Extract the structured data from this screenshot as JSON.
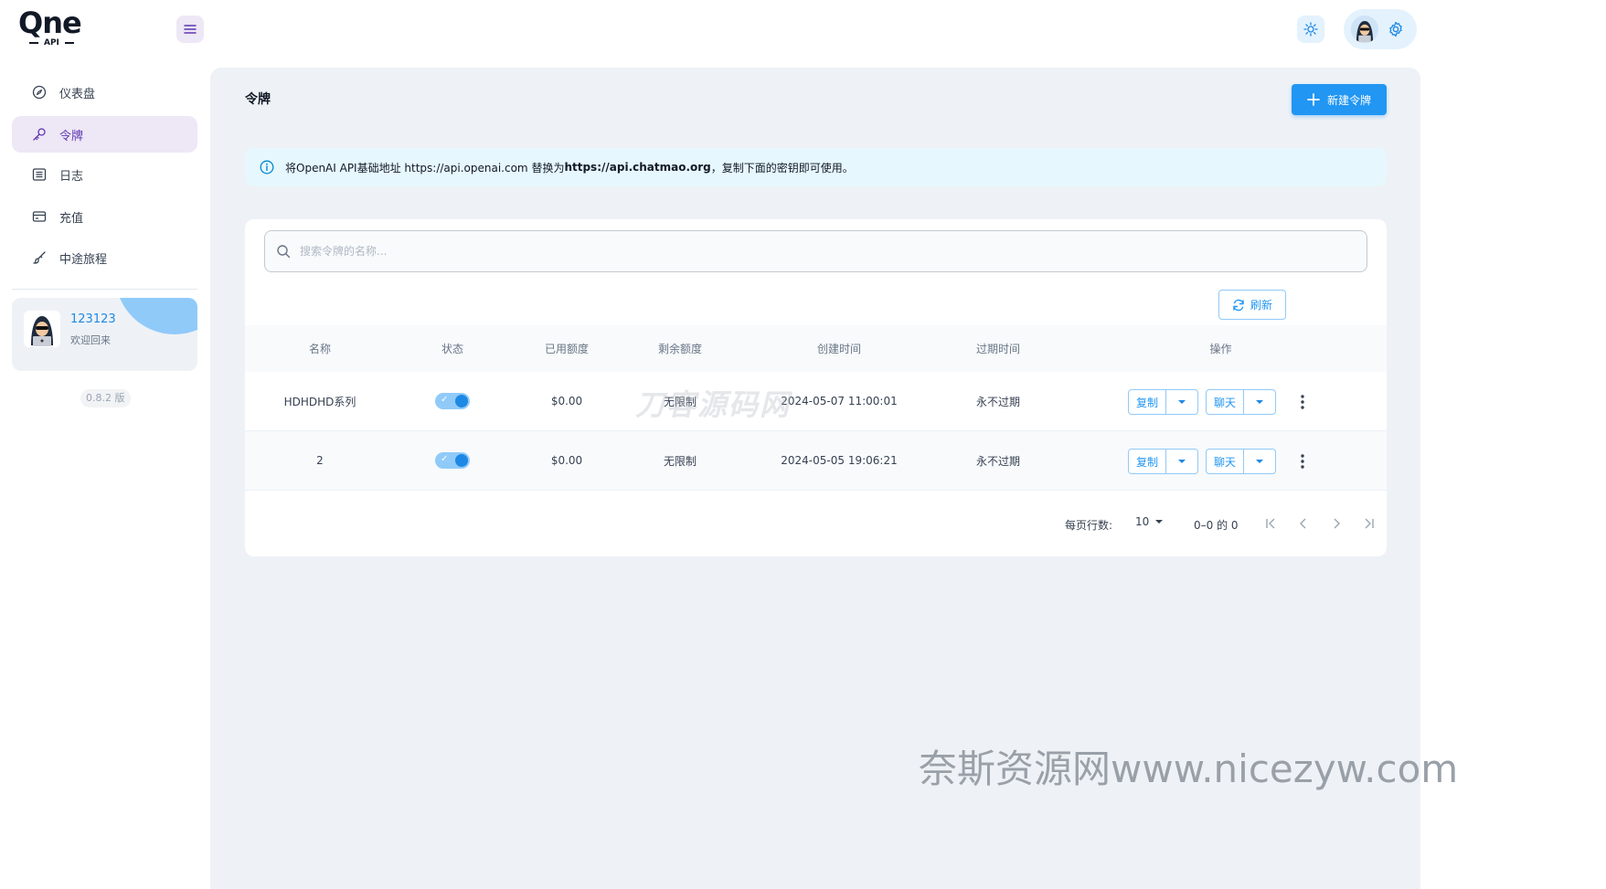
{
  "app": {
    "logo_text": "Qne",
    "logo_sub": "API"
  },
  "sidebar": {
    "items": [
      {
        "label": "仪表盘",
        "icon": "dashboard-icon"
      },
      {
        "label": "令牌",
        "icon": "key-icon",
        "active": true
      },
      {
        "label": "日志",
        "icon": "log-icon"
      },
      {
        "label": "充值",
        "icon": "wallet-icon"
      },
      {
        "label": "中途旅程",
        "icon": "brush-icon"
      }
    ],
    "user": {
      "name": "123123",
      "welcome": "欢迎回来"
    },
    "version": "0.8.2 版"
  },
  "page": {
    "title": "令牌",
    "new_button": "新建令牌",
    "info": {
      "prefix": "将OpenAI API基础地址 https://api.openai.com 替换为 ",
      "url": "https://api.chatmao.org",
      "suffix": "，复制下面的密钥即可使用。"
    },
    "search_placeholder": "搜索令牌的名称...",
    "refresh_label": "刷新"
  },
  "table": {
    "headers": {
      "name": "名称",
      "status": "状态",
      "used": "已用额度",
      "remaining": "剩余额度",
      "created": "创建时间",
      "expire": "过期时间",
      "ops": "操作"
    },
    "rows": [
      {
        "name": "HDHDHD系列",
        "enabled": true,
        "used": "$0.00",
        "remaining": "无限制",
        "created": "2024-05-07 11:00:01",
        "expire": "永不过期",
        "copy": "复制",
        "chat": "聊天"
      },
      {
        "name": "2",
        "enabled": true,
        "used": "$0.00",
        "remaining": "无限制",
        "created": "2024-05-05 19:06:21",
        "expire": "永不过期",
        "copy": "复制",
        "chat": "聊天"
      }
    ]
  },
  "pagination": {
    "rows_per_page_label": "每页行数:",
    "rows_per_page": "10",
    "range": "0–0 的 0"
  },
  "watermarks": {
    "overlay": "刀客源码网",
    "site": "奈斯资源网www.nicezyw.com"
  },
  "colors": {
    "primary": "#2196f3",
    "secondary": "#5e35b1",
    "active_bg": "#ede7f6",
    "main_bg": "#eef2f6"
  }
}
